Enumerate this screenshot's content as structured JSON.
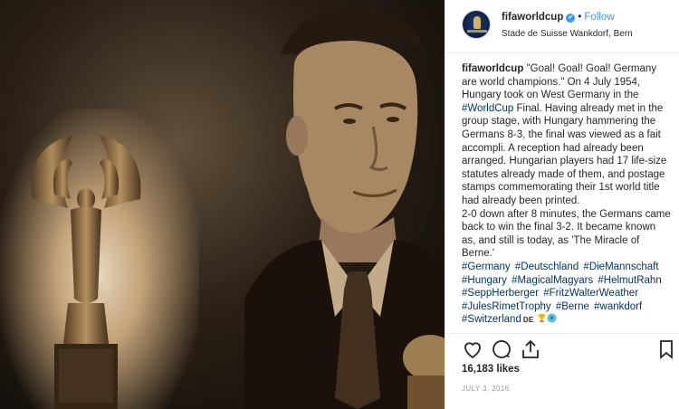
{
  "post": {
    "user": {
      "handle": "fifaworldcup",
      "verified_mark": "✔",
      "separator": "•",
      "follow_label": "Follow"
    },
    "location": "Stade de Suisse Wankdorf, Bern",
    "caption": {
      "author": "fifaworldcup",
      "p1_before_link": "\"Goal! Goal! Goal! Germany are world champions.\" On 4 July 1954, Hungary took on West Germany in the ",
      "p1_link": "#WorldCup",
      "p1_after_link": " Final. Having already met in the group stage, with Hungary hammering the Germans 8-3, the final was viewed as a fait accompli. A reception had already been arranged. Hungarian players had 17 life-size statutes already made of them, and postage stamps commemorating their 1st world title had already been printed.",
      "p2": "2-0 down after 8 minutes, the Germans came back to win the final 3-2. It became known as, and still is today, as 'The Miracle of Berne.'",
      "hashtags": [
        "#Germany",
        "#Deutschland",
        "#DieMannschaft",
        "#Hungary",
        "#MagicalMagyars",
        "#HelmutRahn",
        "#SeppHerberger",
        "#FritzWalterWeather",
        "#JulesRimetTrophy",
        "#Berne",
        "#wankdorf",
        "#Switzerland"
      ],
      "flag_text": "DE",
      "trailing_emojis": [
        "trophy-emoji",
        "soccer-ball-emoji"
      ]
    },
    "likes_text": "16,183 likes",
    "date_text": "JULY 3, 2016",
    "icons": [
      "heart-icon",
      "comment-icon",
      "share-icon",
      "bookmark-icon"
    ],
    "colors": {
      "link": "#003569",
      "follow": "#3897f0",
      "text": "#262626",
      "muted": "#999999"
    }
  }
}
